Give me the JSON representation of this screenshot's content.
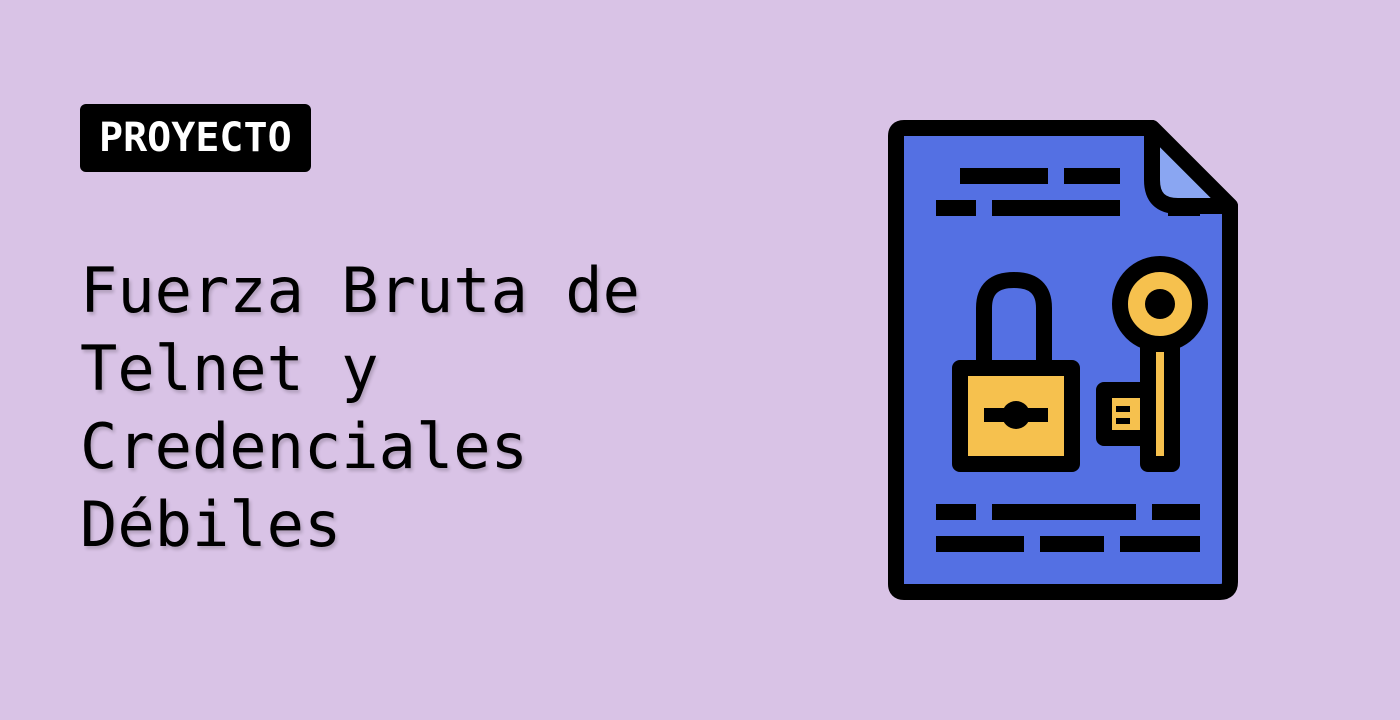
{
  "tag": {
    "label": "PROYECTO"
  },
  "title": {
    "lines": [
      "Fuerza Bruta de",
      "Telnet y",
      "Credenciales",
      "Débiles"
    ]
  },
  "illustration": {
    "icons": [
      "document-icon",
      "open-padlock-icon",
      "key-icon"
    ],
    "colors": {
      "background": "#d9c3e6",
      "document": "#5470e3",
      "document_fold": "#8aa6f2",
      "padlock_and_key": "#f6c14e",
      "outline": "#000000"
    }
  }
}
